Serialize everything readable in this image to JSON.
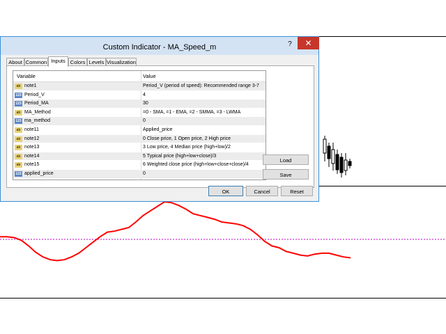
{
  "dialog": {
    "title": "Custom Indicator - MA_Speed_m",
    "help": "?",
    "close": "✕"
  },
  "tabs": [
    "About",
    "Common",
    "Inputs",
    "Colors",
    "Levels",
    "Visualization"
  ],
  "active_tab": "Inputs",
  "grid": {
    "header_variable": "Variable",
    "header_value": "Value",
    "rows": [
      {
        "type": "ab",
        "name": "note1",
        "value": "Period_V (period of speed): Recommended range 3-7"
      },
      {
        "type": "num",
        "name": "Period_V",
        "value": "4"
      },
      {
        "type": "num",
        "name": "Period_MA",
        "value": "30"
      },
      {
        "type": "ab",
        "name": "MA_Method",
        "value": "=0 - SMA, =1 - EMA, =2 - SMMA, =3 - LWMA"
      },
      {
        "type": "num",
        "name": "ma_method",
        "value": "0"
      },
      {
        "type": "ab",
        "name": "note11",
        "value": "Applied_price"
      },
      {
        "type": "ab",
        "name": "note12",
        "value": "0 Close price, 1 Open price, 2 High price"
      },
      {
        "type": "ab",
        "name": "note13",
        "value": "3 Low price, 4 Median price (high+low)/2"
      },
      {
        "type": "ab",
        "name": "note14",
        "value": "5 Typical price (high+low+close)/3"
      },
      {
        "type": "ab",
        "name": "note15",
        "value": "6 Weighted close price (high+low+close+close)/4"
      },
      {
        "type": "num",
        "name": "applied_price",
        "value": "0"
      }
    ],
    "icon_ab": "ab",
    "icon_num": "123"
  },
  "buttons": {
    "load": "Load",
    "save": "Save",
    "ok": "OK",
    "cancel": "Cancel",
    "reset": "Reset"
  },
  "colors": {
    "indicator_line": "#ff0000",
    "level_line": "#c000c0"
  },
  "chart_data": {
    "type": "line",
    "series": [
      {
        "values": [
          62,
          62,
          61,
          58,
          52,
          45,
          40,
          37,
          36,
          37,
          40,
          44,
          50,
          56,
          62,
          67,
          68,
          70,
          72,
          78,
          85,
          90,
          95,
          100,
          99,
          96,
          92,
          87,
          85,
          83,
          81,
          78,
          77,
          76,
          74,
          70,
          64,
          57,
          52,
          50,
          46,
          44,
          42,
          41,
          43,
          44,
          44,
          42,
          40,
          39
        ]
      }
    ]
  }
}
